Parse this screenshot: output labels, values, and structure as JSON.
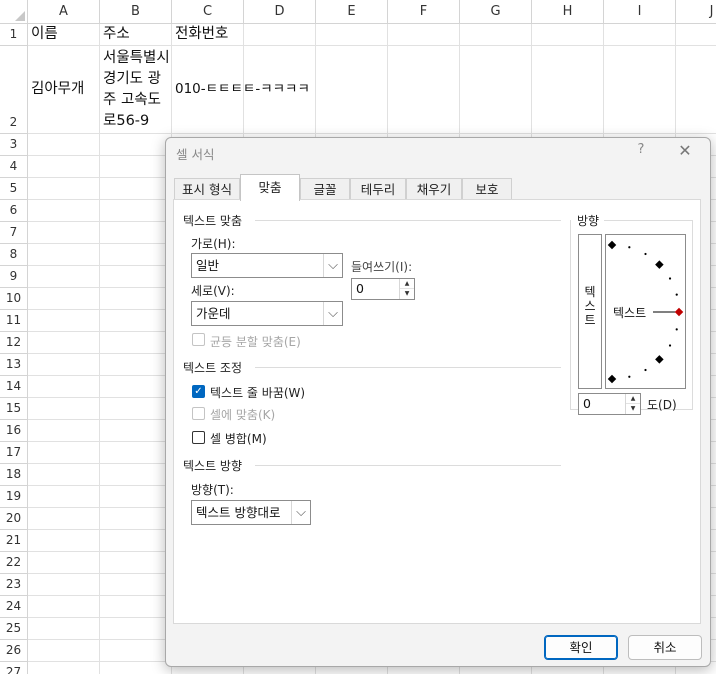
{
  "spreadsheet": {
    "columns": [
      "A",
      "B",
      "C",
      "D",
      "E",
      "F",
      "G",
      "H",
      "I",
      "J"
    ],
    "rows": [
      "1",
      "2",
      "3",
      "4",
      "5",
      "6",
      "7",
      "8",
      "9",
      "10",
      "11",
      "12",
      "13",
      "14",
      "15",
      "16",
      "17",
      "18",
      "19",
      "20",
      "21",
      "22",
      "23",
      "24",
      "25",
      "26",
      "27"
    ],
    "cells": {
      "A1": "이름",
      "B1": "주소",
      "C1": "전화번호",
      "A2": "김아무개",
      "B2": "서울특별시 경기도 광주 고속도로56-9",
      "C2": "010-ㅌㅌㅌㅌ-ㅋㅋㅋㅋ"
    }
  },
  "dialog": {
    "title": "셀 서식",
    "help": "?",
    "close": "✕",
    "tabs": [
      "표시 형식",
      "맞춤",
      "글꼴",
      "테두리",
      "채우기",
      "보호"
    ],
    "active_tab": "맞춤",
    "alignment": {
      "section_title": "텍스트 맞춤",
      "horizontal_label": "가로(H):",
      "horizontal_value": "일반",
      "indent_label": "들여쓰기(I):",
      "indent_value": "0",
      "vertical_label": "세로(V):",
      "vertical_value": "가운데",
      "justify_distributed_label": "균등 분할 맞춤(E)",
      "justify_distributed_checked": false
    },
    "control": {
      "section_title": "텍스트 조정",
      "wrap_text_label": "텍스트 줄 바꿈(W)",
      "wrap_text_checked": true,
      "shrink_to_fit_label": "셀에 맞춤(K)",
      "shrink_to_fit_checked": false,
      "merge_cells_label": "셀 병합(M)",
      "merge_cells_checked": false
    },
    "direction": {
      "section_title": "텍스트 방향",
      "label": "방향(T):",
      "value": "텍스트 방향대로"
    },
    "orientation": {
      "title": "방향",
      "vertical_text": "텍스트",
      "dial_text": "텍스트",
      "degrees_value": "0",
      "degrees_label": "도(D)",
      "angle_degrees": 0
    },
    "buttons": {
      "ok": "확인",
      "cancel": "취소"
    },
    "colors": {
      "accent": "#0067c0",
      "dial_marker": "#c00000"
    }
  }
}
